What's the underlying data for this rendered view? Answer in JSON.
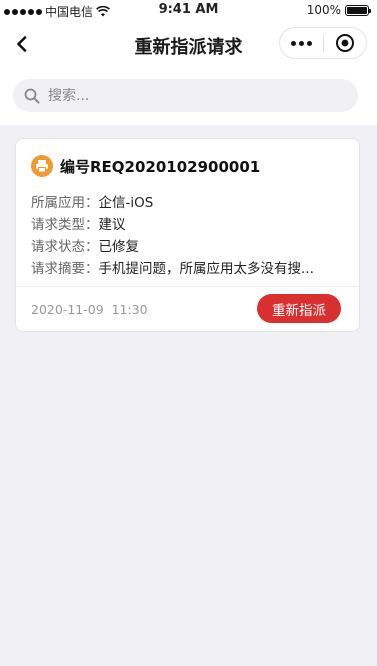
{
  "status_bar": {
    "carrier": "中国电信",
    "time": "9:41 AM",
    "battery": "100%"
  },
  "nav": {
    "title": "重新指派请求"
  },
  "search": {
    "placeholder": "搜索..."
  },
  "request": {
    "title": "编号REQ2020102900001",
    "fields": [
      {
        "label": "所属应用：",
        "value": "企信-iOS"
      },
      {
        "label": "请求类型：",
        "value": "建议"
      },
      {
        "label": "请求状态：",
        "value": "已修复"
      },
      {
        "label": "请求摘要：",
        "value": "手机提问题，所属应用太多没有搜..."
      }
    ],
    "time": "2020-11-09  11:30",
    "button_label": "重新指派"
  },
  "colors": {
    "accent": "#d9302f",
    "icon_bg": "#f29a2e",
    "page_bg": "#f1f1f5"
  },
  "icons": {
    "back": "chevron-left-icon",
    "more": "more-dots-icon",
    "target": "target-icon",
    "search": "search-icon",
    "request": "printer-icon",
    "wifi": "wifi-icon",
    "battery": "battery-icon"
  }
}
